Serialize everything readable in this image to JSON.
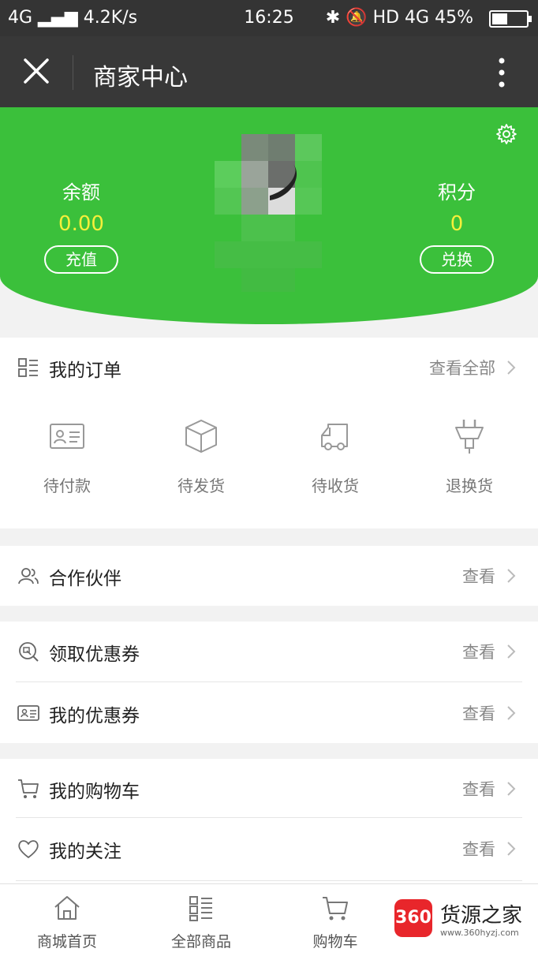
{
  "status_bar": {
    "network": "4G",
    "speed": "4.2K/s",
    "time": "16:25",
    "right_indicators": "HD 4G",
    "battery": "45%",
    "battery_level": 0.45
  },
  "title_bar": {
    "title": "商家中心",
    "close_icon": "close-icon",
    "more_icon": "more-vertical-icon"
  },
  "header": {
    "bg_color": "#3bc03b",
    "balance_label": "余额",
    "balance_value": "0.00",
    "recharge_button": "充值",
    "points_label": "积分",
    "points_value": "0",
    "exchange_button": "兑换",
    "settings_icon": "gear-icon"
  },
  "orders": {
    "title": "我的订单",
    "view_all": "查看全部",
    "items": [
      {
        "label": "待付款",
        "icon": "id-card-icon"
      },
      {
        "label": "待发货",
        "icon": "box-icon"
      },
      {
        "label": "待收货",
        "icon": "truck-icon"
      },
      {
        "label": "退换货",
        "icon": "plug-icon"
      }
    ]
  },
  "partners": {
    "label": "合作伙伴",
    "action": "查看"
  },
  "coupons": [
    {
      "label": "领取优惠券",
      "action": "查看"
    },
    {
      "label": "我的优惠券",
      "action": "查看"
    }
  ],
  "shopping": [
    {
      "label": "我的购物车",
      "action": "查看"
    },
    {
      "label": "我的关注",
      "action": "查看"
    }
  ],
  "bottom_nav": [
    {
      "label": "商城首页",
      "icon": "home-icon"
    },
    {
      "label": "全部商品",
      "icon": "list-icon"
    },
    {
      "label": "购物车",
      "icon": "cart-icon"
    }
  ],
  "watermark": {
    "badge": "360",
    "title": "货源之家",
    "url": "www.360hyzj.com"
  }
}
